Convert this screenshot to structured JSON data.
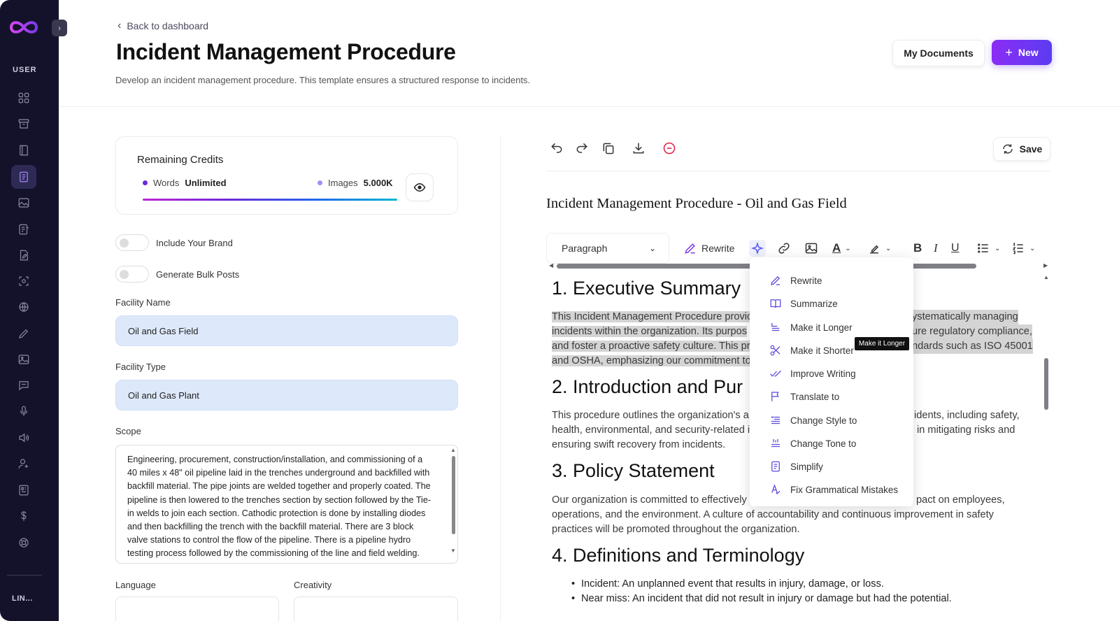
{
  "sidebar": {
    "section_label": "USER",
    "bottom_label": "LIN..."
  },
  "header": {
    "back_label": "Back to dashboard",
    "title": "Incident Management Procedure",
    "description": "Develop an incident management procedure. This template ensures a structured response to incidents.",
    "my_documents_label": "My Documents",
    "new_label": "New"
  },
  "credits": {
    "title": "Remaining Credits",
    "words_label": "Words",
    "words_value": "Unlimited",
    "images_label": "Images",
    "images_value": "5.000K",
    "words_dot_color": "#6d28d9",
    "images_dot_color": "#a78bfa"
  },
  "form": {
    "include_brand_label": "Include Your Brand",
    "bulk_posts_label": "Generate Bulk Posts",
    "facility_name_label": "Facility Name",
    "facility_name_value": "Oil and Gas Field",
    "facility_type_label": "Facility Type",
    "facility_type_value": "Oil and Gas Plant",
    "scope_label": "Scope",
    "scope_value": "Engineering, procurement, construction/installation, and commissioning of a 40 miles x 48\" oil pipeline laid in the trenches underground and backfilled with backfill material. The pipe joints are welded together and properly coated. The pipeline is then lowered to the trenches section by section followed by the Tie-in welds to join each section. Cathodic protection is done by installing diodes and then backfilling the trench with the backfill material. There are 3 block valve stations to control the flow of the pipeline. There is a pipeline hydro testing process followed by the commissioning of the line and field welding.",
    "language_label": "Language",
    "creativity_label": "Creativity"
  },
  "editor": {
    "save_label": "Save",
    "doc_title": "Incident Management Procedure - Oil and Gas Field",
    "paragraph_select": "Paragraph",
    "rewrite_label": "Rewrite",
    "sections": {
      "h1": "1. Executive Summary",
      "p1_line1a": "This Incident Management Procedure provic",
      "p1_line1b": "ystematically managing",
      "p1_line2a": "incidents within the organization. Its purpos",
      "p1_line2b": "ure regulatory compliance,",
      "p1_line3a": "and foster a proactive safety culture. This pr",
      "p1_line3b": "ndards such as ISO 45001",
      "p1_line4a": "and OSHA, emphasizing our commitment to",
      "h2": "2. Introduction and Pur",
      "p2_line1a": "This procedure outlines the organization's a",
      "p2_line1b": "idents, including safety,",
      "p2_line2a": "health, environmental, and security-related i",
      "p2_line2b": "in mitigating risks and",
      "p2_line3": "ensuring swift recovery from incidents.",
      "h3": "3. Policy Statement",
      "p3_line1a": "Our organization is committed to effectively",
      "p3_line1b": "pact on employees,",
      "p3_line2": "operations, and the environment. A culture of accountability and continuous improvement in safety",
      "p3_line3": "practices will be promoted throughout the organization.",
      "h4": "4. Definitions and Terminology",
      "li1": "Incident: An unplanned event that results in injury, damage, or loss.",
      "li2": "Near miss: An incident that did not result in injury or damage but had the potential."
    }
  },
  "ai_menu": {
    "items": [
      "Rewrite",
      "Summarize",
      "Make it Longer",
      "Make it Shorter",
      "Improve Writing",
      "Translate to",
      "Change Style to",
      "Change Tone to",
      "Simplify",
      "Fix Grammatical Mistakes"
    ],
    "tooltip": "Make it Longer"
  }
}
